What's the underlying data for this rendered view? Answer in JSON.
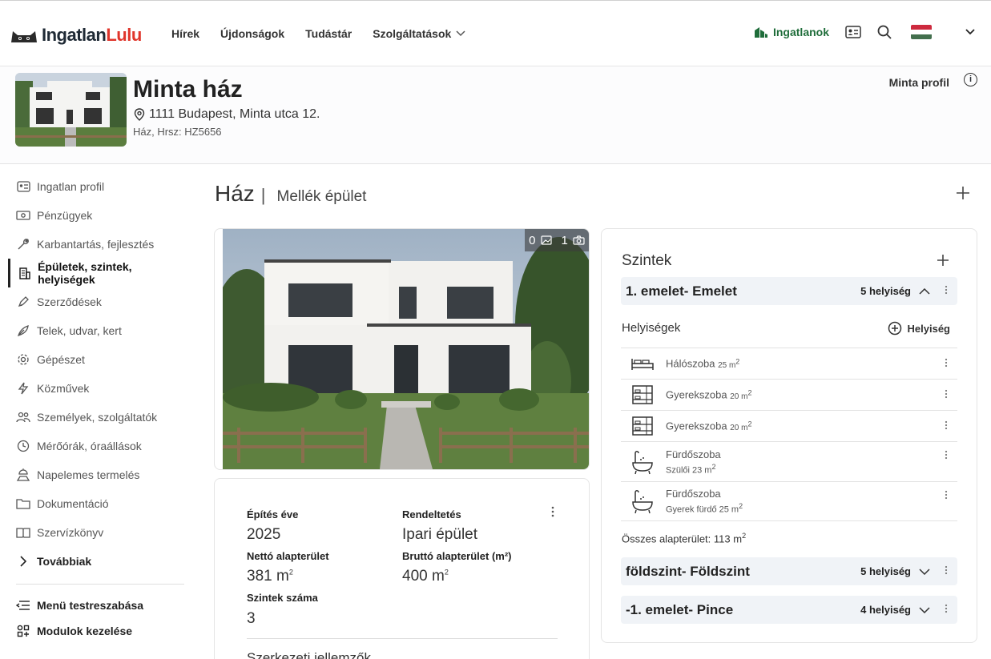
{
  "topbar": {
    "logo": {
      "part1": "Ingatlan",
      "part2": "Lulu"
    },
    "nav": [
      "Hírek",
      "Újdonságok",
      "Tudástár",
      "Szolgáltatások"
    ],
    "ingatlanok": "Ingatlanok",
    "icons": [
      "house-icon",
      "id-card-icon",
      "search-icon",
      "flag-hu-icon",
      "chevron-down-icon"
    ],
    "colors": {
      "brand_red": "#e0352b",
      "ingatlanok_green": "#1f6d3a"
    }
  },
  "property": {
    "title": "Minta ház",
    "address": "1111 Budapest, Minta utca 12.",
    "hrsz": "Ház, Hrsz: HZ5656",
    "profil_link": "Minta profil"
  },
  "sidebar": {
    "items": [
      {
        "label": "Ingatlan profil",
        "icon": "id-card-icon"
      },
      {
        "label": "Pénzügyek",
        "icon": "money-icon"
      },
      {
        "label": "Karbantartás, fejlesztés",
        "icon": "wrench-icon"
      },
      {
        "label": "Épületek, szintek, helyiségek",
        "icon": "building-icon"
      },
      {
        "label": "Szerződések",
        "icon": "contract-icon"
      },
      {
        "label": "Telek, udvar, kert",
        "icon": "leaf-icon"
      },
      {
        "label": "Gépészet",
        "icon": "gear-icon"
      },
      {
        "label": "Közművek",
        "icon": "lightning-icon"
      },
      {
        "label": "Személyek, szolgáltatók",
        "icon": "people-icon"
      },
      {
        "label": "Mérőórák, óraállások",
        "icon": "clock-icon"
      },
      {
        "label": "Napelemes termelés",
        "icon": "solar-icon"
      },
      {
        "label": "Dokumentáció",
        "icon": "folder-icon"
      },
      {
        "label": "Szervízkönyv",
        "icon": "book-icon"
      }
    ],
    "more": "Továbbiak",
    "menu_custom": "Menü testreszabása",
    "modules": "Modulok kezelése"
  },
  "main": {
    "tab_active": "Ház",
    "tab_other": "Mellék épület",
    "photo_counts": {
      "images": "0",
      "photos": "1"
    }
  },
  "details": {
    "year_label": "Építés éve",
    "year_value": "2025",
    "usage_label": "Rendeltetés",
    "usage_value": "Ipari épület",
    "net_label": "Nettó alapterület",
    "net_value": "381 m",
    "gross_label": "Bruttó alapterület (m²)",
    "gross_value": "400 m",
    "levels_label": "Szintek száma",
    "levels_value": "3",
    "more_section": "Szerkezeti jellemzők"
  },
  "levels": {
    "title": "Szintek",
    "list": [
      {
        "name": "1. emelet- Emelet",
        "count": "5 helyiség",
        "open": true
      },
      {
        "name": "földszint- Földszint",
        "count": "5 helyiség",
        "open": false
      },
      {
        "name": "-1. emelet- Pince",
        "count": "4 helyiség",
        "open": false
      }
    ],
    "rooms_title": "Helyiségek",
    "add_room": "Helyiség",
    "rooms": [
      {
        "name": "Hálószoba",
        "area": "25 m",
        "sub": "",
        "icon": "bed-icon"
      },
      {
        "name": "Gyerekszoba",
        "area": "20 m",
        "sub": "",
        "icon": "bunk-bed-icon"
      },
      {
        "name": "Gyerekszoba",
        "area": "20 m",
        "sub": "",
        "icon": "bunk-bed-icon"
      },
      {
        "name": "Fürdőszoba",
        "area": "",
        "sub": "Szülői 23 m",
        "icon": "bathtub-icon"
      },
      {
        "name": "Fürdőszoba",
        "area": "",
        "sub": "Gyerek fürdő 25 m",
        "icon": "bathtub-icon"
      }
    ],
    "total": "Összes alapterület: 113 m"
  }
}
